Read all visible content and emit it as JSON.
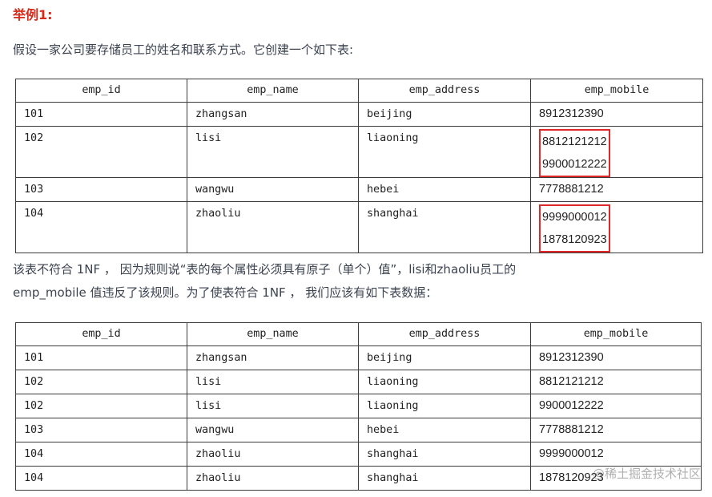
{
  "heading": "举例1:",
  "paragraph1": "假设一家公司要存储员工的姓名和联系方式。它创建一个如下表:",
  "paragraph2_line1": "该表不符合 1NF ， 因为规则说“表的每个属性必须具有原子（单个）值”，lisi和zhaoliu员工的",
  "paragraph2_line2": "emp_mobile 值违反了该规则。为了使表符合 1NF ， 我们应该有如下表数据：",
  "table1": {
    "headers": [
      "emp_id",
      "emp_name",
      "emp_address",
      "emp_mobile"
    ],
    "rows": [
      {
        "id": "101",
        "name": "zhangsan",
        "address": "beijing",
        "mobiles": [
          "8912312390"
        ]
      },
      {
        "id": "102",
        "name": "lisi",
        "address": "liaoning",
        "mobiles": [
          "8812121212",
          "9900012222"
        ]
      },
      {
        "id": "103",
        "name": "wangwu",
        "address": "hebei",
        "mobiles": [
          "7778881212"
        ]
      },
      {
        "id": "104",
        "name": "zhaoliu",
        "address": "shanghai",
        "mobiles": [
          "9999000012",
          "1878120923"
        ]
      }
    ]
  },
  "table2": {
    "headers": [
      "emp_id",
      "emp_name",
      "emp_address",
      "emp_mobile"
    ],
    "rows": [
      {
        "id": "101",
        "name": "zhangsan",
        "address": "beijing",
        "mobile": "8912312390"
      },
      {
        "id": "102",
        "name": "lisi",
        "address": "liaoning",
        "mobile": "8812121212"
      },
      {
        "id": "102",
        "name": "lisi",
        "address": "liaoning",
        "mobile": "9900012222"
      },
      {
        "id": "103",
        "name": "wangwu",
        "address": "hebei",
        "mobile": "7778881212"
      },
      {
        "id": "104",
        "name": "zhaoliu",
        "address": "shanghai",
        "mobile": "9999000012"
      },
      {
        "id": "104",
        "name": "zhaoliu",
        "address": "shanghai",
        "mobile": "1878120923"
      }
    ]
  },
  "watermark": "@稀土掘金技术社区",
  "colors": {
    "heading": "#d9291a",
    "highlight_box": "#e02828",
    "table_border": "#3c3c3c"
  }
}
